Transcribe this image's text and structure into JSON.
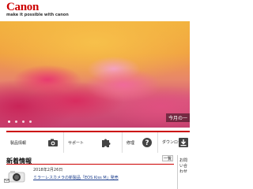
{
  "header": {
    "logo_text": "Canon",
    "tagline": "make it possible with canon"
  },
  "hero": {
    "caption": "今月の一",
    "slide_count": 4,
    "active_slide": 1
  },
  "nav": {
    "items": [
      {
        "label": "製品情報",
        "icon": "camera-icon"
      },
      {
        "label": "サポート",
        "icon": "puzzle-icon"
      },
      {
        "label": "修理",
        "icon": "help-icon"
      },
      {
        "label": "ダウンロード",
        "icon": "download-icon"
      }
    ]
  },
  "news": {
    "title": "新着情報",
    "more_label": "一覧",
    "items": [
      {
        "date": "2018年2月26日",
        "text": "ミラーレスカメラの新製品「EOS Kiss M」発売",
        "thumb_icon": "camera-product-icon"
      }
    ]
  },
  "side_tab": {
    "label": "お問い合わせ"
  },
  "colors": {
    "brand_red": "#cc0000",
    "link_blue": "#1a3c8c"
  }
}
